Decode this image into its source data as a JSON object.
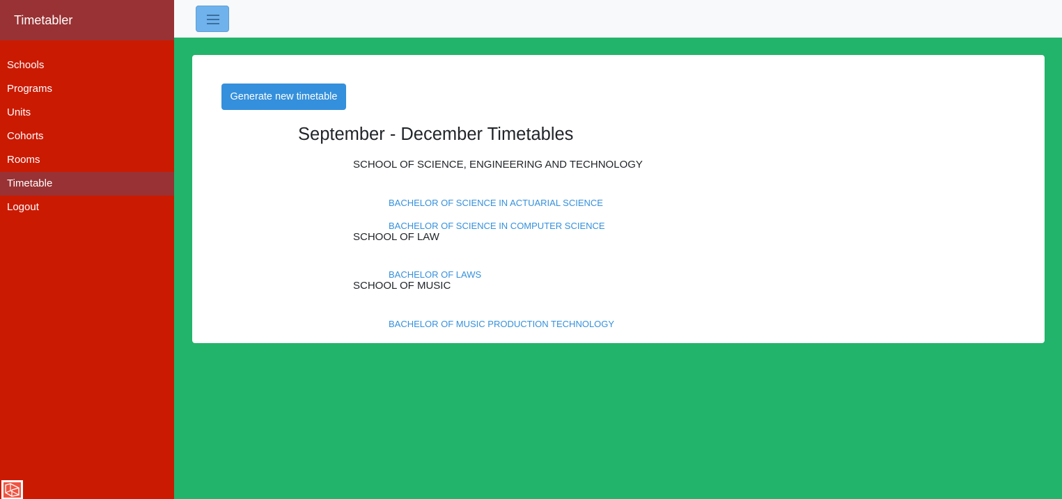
{
  "app": {
    "brand": "Timetabler"
  },
  "sidebar": {
    "items": [
      {
        "label": "Schools"
      },
      {
        "label": "Programs"
      },
      {
        "label": "Units"
      },
      {
        "label": "Cohorts"
      },
      {
        "label": "Rooms"
      },
      {
        "label": "Timetable",
        "active": true
      },
      {
        "label": "Logout"
      }
    ],
    "logo_icon": "laravel-logo-icon"
  },
  "topbar": {
    "toggler_icon": "hamburger-menu-icon"
  },
  "main": {
    "generate_button": "Generate new timetable",
    "title": "September - December Timetables",
    "schools": [
      {
        "name": "SCHOOL OF SCIENCE, ENGINEERING AND TECHNOLOGY",
        "programs": [
          "BACHELOR OF SCIENCE IN ACTUARIAL SCIENCE",
          "BACHELOR OF SCIENCE IN COMPUTER SCIENCE"
        ]
      },
      {
        "name": "SCHOOL OF LAW",
        "programs": [
          "BACHELOR OF LAWS"
        ]
      },
      {
        "name": "SCHOOL OF MUSIC",
        "programs": [
          "BACHELOR OF MUSIC PRODUCTION TECHNOLOGY"
        ]
      }
    ]
  },
  "colors": {
    "sidebar_bg": "#cb1a02",
    "sidebar_active": "#983234",
    "content_bg": "#22b46a",
    "primary": "#3490dc"
  }
}
